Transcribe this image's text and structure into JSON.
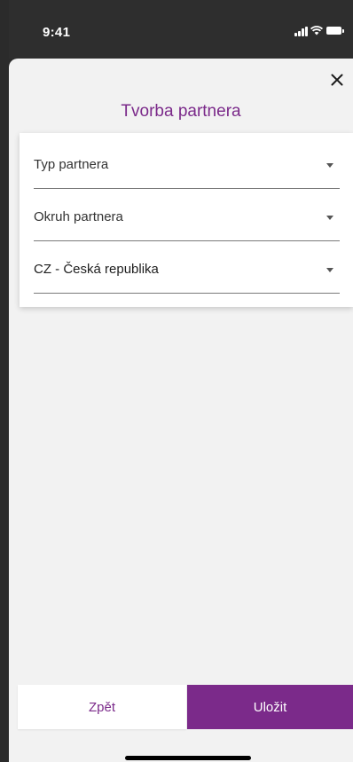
{
  "status_bar": {
    "time": "9:41",
    "icons": [
      "signal-icon",
      "wifi-icon",
      "battery-icon"
    ]
  },
  "sheet": {
    "title": "Tvorba partnera",
    "close_icon": "close-icon"
  },
  "form": {
    "fields": [
      {
        "label": "Typ partnera",
        "icon": "chevron-down-icon"
      },
      {
        "label": "Okruh partnera",
        "icon": "chevron-down-icon"
      },
      {
        "label": "CZ - Česká republika",
        "icon": "chevron-down-icon"
      }
    ]
  },
  "footer": {
    "back_label": "Zpět",
    "save_label": "Uložit"
  },
  "colors": {
    "accent": "#7b2a8a",
    "sheet_background": "#f2f2f2",
    "status_bar_background": "#2e2e2e"
  }
}
